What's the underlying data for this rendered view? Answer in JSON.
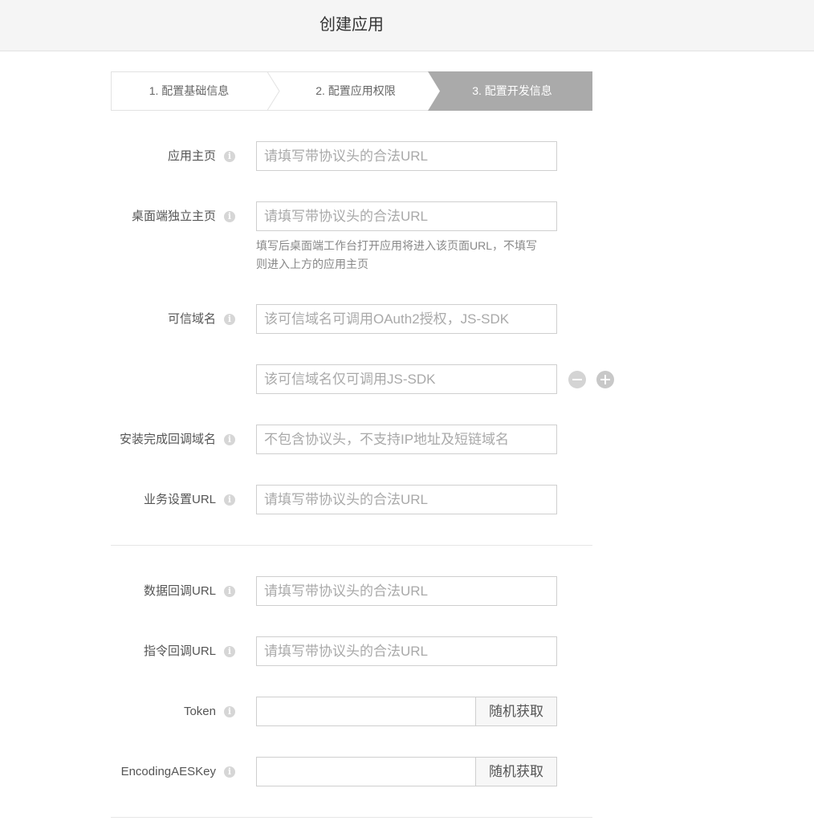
{
  "header": {
    "title": "创建应用"
  },
  "steps": [
    {
      "label": "1. 配置基础信息",
      "active": false
    },
    {
      "label": "2. 配置应用权限",
      "active": false
    },
    {
      "label": "3. 配置开发信息",
      "active": true
    }
  ],
  "fields": {
    "homepage": {
      "label": "应用主页",
      "placeholder": "请填写带协议头的合法URL"
    },
    "desktop_homepage": {
      "label": "桌面端独立主页",
      "placeholder": "请填写带协议头的合法URL",
      "hint_line1": "填写后桌面端工作台打开应用将进入该页面URL，不填写",
      "hint_line2": "则进入上方的应用主页"
    },
    "trusted_domain": {
      "label": "可信域名",
      "placeholder": "该可信域名可调用OAuth2授权，JS-SDK"
    },
    "trusted_domain_2": {
      "placeholder": "该可信域名仅可调用JS-SDK"
    },
    "install_callback_domain": {
      "label": "安装完成回调域名",
      "placeholder": "不包含协议头，不支持IP地址及短链域名"
    },
    "business_settings_url": {
      "label": "业务设置URL",
      "placeholder": "请填写带协议头的合法URL"
    },
    "data_callback_url": {
      "label": "数据回调URL",
      "placeholder": "请填写带协议头的合法URL"
    },
    "command_callback_url": {
      "label": "指令回调URL",
      "placeholder": "请填写带协议头的合法URL"
    },
    "token": {
      "label": "Token",
      "value": "",
      "button": "随机获取"
    },
    "encoding_aes_key": {
      "label": "EncodingAESKey",
      "value": "",
      "button": "随机获取"
    }
  },
  "icons": {
    "info": "info-icon",
    "remove": "minus-circle-icon",
    "add": "plus-circle-icon"
  },
  "colors": {
    "active_step_bg": "#aaaaaa",
    "header_bg": "#f5f5f5"
  }
}
